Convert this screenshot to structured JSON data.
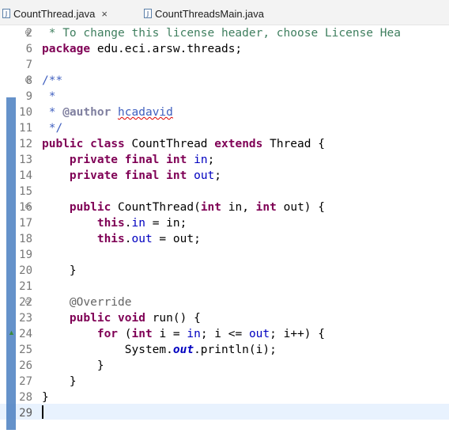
{
  "tabs": [
    {
      "label": "CountThread.java",
      "icon": "java-file-icon",
      "active": true,
      "close": "×"
    },
    {
      "label": "CountThreadsMain.java",
      "icon": "java-file-icon",
      "active": false
    }
  ],
  "editor": {
    "lines": [
      {
        "n": "2",
        "fold": "⊕",
        "code": " * To change this license header, choose License Hea"
      },
      {
        "n": "6",
        "code": "package edu.eci.arsw.threads;"
      },
      {
        "n": "7",
        "code": ""
      },
      {
        "n": "8",
        "fold": "⊖",
        "code": "/**"
      },
      {
        "n": "9",
        "code": " *"
      },
      {
        "n": "10",
        "code": " * @author hcadavid"
      },
      {
        "n": "11",
        "code": " */"
      },
      {
        "n": "12",
        "code": "public class CountThread extends Thread {"
      },
      {
        "n": "13",
        "code": "    private final int in;"
      },
      {
        "n": "14",
        "code": "    private final int out;"
      },
      {
        "n": "15",
        "code": ""
      },
      {
        "n": "16",
        "fold": "⊖",
        "code": "    public CountThread(int in, int out) {"
      },
      {
        "n": "17",
        "code": "        this.in = in;"
      },
      {
        "n": "18",
        "code": "        this.out = out;"
      },
      {
        "n": "19",
        "code": ""
      },
      {
        "n": "20",
        "code": "    }"
      },
      {
        "n": "21",
        "code": ""
      },
      {
        "n": "22",
        "fold": "⊖",
        "code": "    @Override"
      },
      {
        "n": "23",
        "code": "    public void run() {"
      },
      {
        "n": "24",
        "code": "        for (int i = in; i <= out; i++) {"
      },
      {
        "n": "25",
        "code": "            System.out.println(i);"
      },
      {
        "n": "26",
        "code": "        }"
      },
      {
        "n": "27",
        "code": "    }"
      },
      {
        "n": "28",
        "code": "}"
      },
      {
        "n": "29",
        "code": ""
      }
    ],
    "current_line": "29"
  },
  "colors": {
    "keyword": "#7f0055",
    "comment": "#3f7f5f",
    "javadoc": "#3f5fbf",
    "field": "#0000c0",
    "annotation": "#646464"
  }
}
